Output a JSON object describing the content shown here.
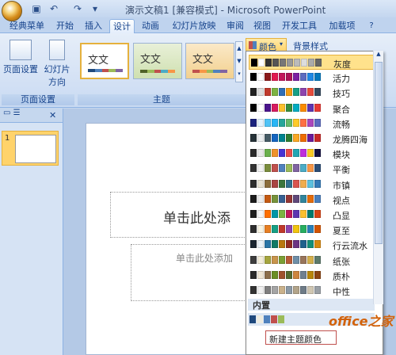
{
  "window": {
    "title": "演示文稿1 [兼容模式] - Microsoft PowerPoint"
  },
  "tabs": [
    "经典菜单",
    "开始",
    "插入",
    "设计",
    "动画",
    "幻灯片放映",
    "审阅",
    "视图",
    "开发工具",
    "加载项"
  ],
  "ribbon": {
    "page_setup_label": "页面设置",
    "slide_orientation_label": "幻灯片",
    "slide_orientation_label2": "方向",
    "page_setup_group": "页面设置",
    "themes_group": "主题",
    "colors_button": "颜色",
    "background_style": "背景样式",
    "theme_text": "文文"
  },
  "slide": {
    "title_placeholder": "单击此处添",
    "subtitle_placeholder": "单击此处添加",
    "thumb_number": "1"
  },
  "colors_menu": {
    "builtin_label": "内置",
    "new_theme_colors": "新建主题颜色",
    "items": [
      {
        "name": "灰度",
        "colors": [
          "#000000",
          "#ffffff",
          "#333333",
          "#555555",
          "#777777",
          "#999999",
          "#bbbbbb",
          "#dddddd",
          "#aaaaaa",
          "#666666"
        ]
      },
      {
        "name": "活力",
        "colors": [
          "#000000",
          "#ffffff",
          "#8b1a1a",
          "#e11a4f",
          "#c2185b",
          "#ad1457",
          "#7b1fa2",
          "#5c6bc0",
          "#1e88e5",
          "#0277bd"
        ]
      },
      {
        "name": "技巧",
        "colors": [
          "#222222",
          "#dddddd",
          "#c0392b",
          "#7cb342",
          "#2f6db5",
          "#f39c12",
          "#16a085",
          "#8e44ad",
          "#e74c3c",
          "#34495e"
        ]
      },
      {
        "name": "聚合",
        "colors": [
          "#000000",
          "#ffffff",
          "#4a148c",
          "#d81b60",
          "#fbc02d",
          "#388e3c",
          "#00acc1",
          "#fb8c00",
          "#5e35b1",
          "#e53935"
        ]
      },
      {
        "name": "流畅",
        "colors": [
          "#1a237e",
          "#e3f2fd",
          "#4fc3f7",
          "#29b6f6",
          "#26a69a",
          "#66bb6a",
          "#ffca28",
          "#ff7043",
          "#ab47bc",
          "#5c6bc0"
        ]
      },
      {
        "name": "龙腾四海",
        "colors": [
          "#263238",
          "#eceff1",
          "#455a64",
          "#1565c0",
          "#00838f",
          "#2e7d32",
          "#f9a825",
          "#ef6c00",
          "#6a1b9a",
          "#c62828"
        ]
      },
      {
        "name": "模块",
        "colors": [
          "#2b2b2b",
          "#e8e8e8",
          "#6ab04c",
          "#f0932b",
          "#4834d4",
          "#eb4d4b",
          "#22a6b3",
          "#be2edd",
          "#f9ca24",
          "#130f40"
        ]
      },
      {
        "name": "平衡",
        "colors": [
          "#333333",
          "#f2f2f2",
          "#7a8c3c",
          "#c0504d",
          "#4f81bd",
          "#9bbb59",
          "#8064a2",
          "#4bacc6",
          "#f79646",
          "#2c4d75"
        ]
      },
      {
        "name": "市镇",
        "colors": [
          "#2d2d2d",
          "#e7e2d3",
          "#8a6d3b",
          "#a94442",
          "#3c763d",
          "#31708f",
          "#d9534f",
          "#f0ad4e",
          "#5bc0de",
          "#337ab7"
        ]
      },
      {
        "name": "视点",
        "colors": [
          "#1c1c1c",
          "#ececec",
          "#c45911",
          "#77933c",
          "#376092",
          "#953735",
          "#60497a",
          "#31859c",
          "#e46c0a",
          "#4a7ebb"
        ]
      },
      {
        "name": "凸显",
        "colors": [
          "#1f1f1f",
          "#f5f5f5",
          "#ff6f00",
          "#0097a7",
          "#7cb342",
          "#c2185b",
          "#5e35b1",
          "#fbc02d",
          "#00796b",
          "#d84315"
        ]
      },
      {
        "name": "夏至",
        "colors": [
          "#2e2e2e",
          "#f8f4e3",
          "#e67e22",
          "#16a085",
          "#c0392b",
          "#8e44ad",
          "#f1c40f",
          "#27ae60",
          "#2980b9",
          "#d35400"
        ]
      },
      {
        "name": "行云流水",
        "colors": [
          "#1b2631",
          "#eaf2f8",
          "#2874a6",
          "#117a65",
          "#b9770e",
          "#922b21",
          "#6c3483",
          "#1f618d",
          "#148f77",
          "#d68910"
        ]
      },
      {
        "name": "纸张",
        "colors": [
          "#3e3e3e",
          "#f4eedb",
          "#a5a53e",
          "#c8954c",
          "#7b9f35",
          "#b85c38",
          "#6f8fa8",
          "#98755b",
          "#d4b04c",
          "#5d7a6b"
        ]
      },
      {
        "name": "质朴",
        "colors": [
          "#2a2a2a",
          "#efe6d5",
          "#8c6e4b",
          "#6b8e23",
          "#a0522d",
          "#556b2f",
          "#cd853f",
          "#708090",
          "#b8860b",
          "#8b4513"
        ]
      },
      {
        "name": "中性",
        "colors": [
          "#333333",
          "#f0f0f0",
          "#7f7f7f",
          "#a5a5a5",
          "#c9b18b",
          "#8c9aa6",
          "#b2a48a",
          "#6e7b87",
          "#d0c7b3",
          "#9aa0a6"
        ]
      }
    ]
  },
  "watermark": "office之家"
}
